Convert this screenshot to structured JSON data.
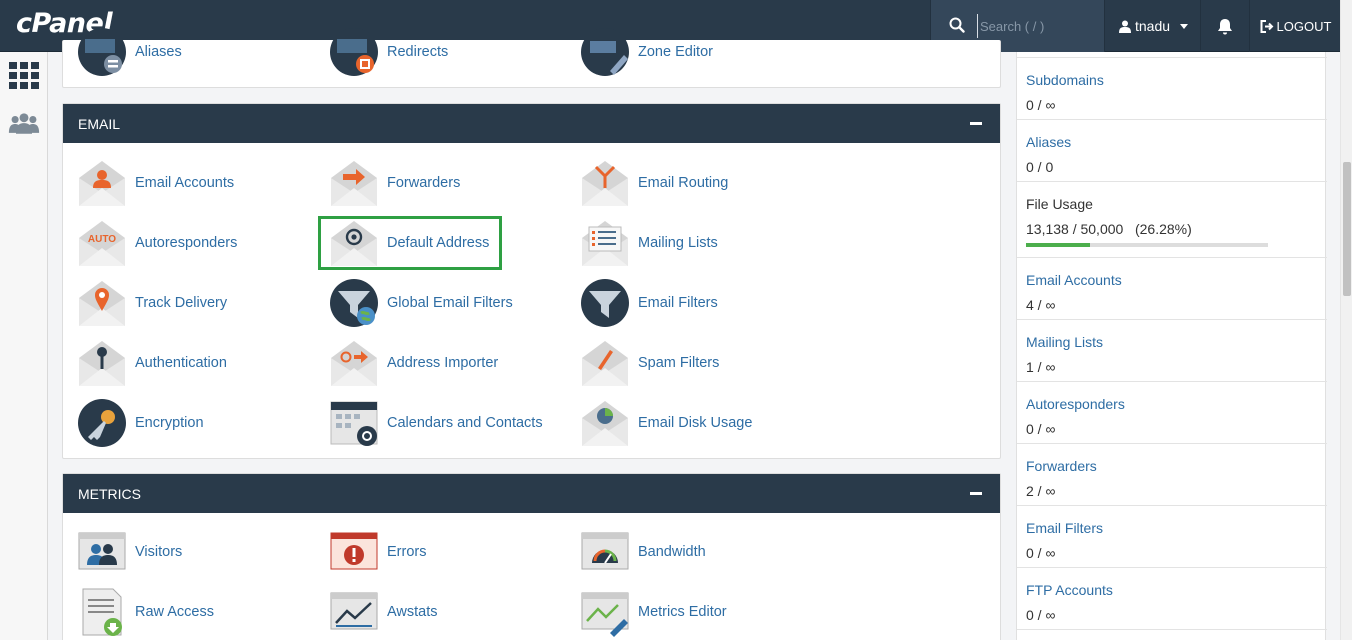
{
  "header": {
    "logo": "cPanel",
    "search_placeholder": "Search ( / )",
    "username": "tnadu",
    "logout_label": "LOGOUT"
  },
  "domains_partial": {
    "items": [
      {
        "label": "Aliases",
        "icon": "aliases-icon"
      },
      {
        "label": "Redirects",
        "icon": "redirects-icon"
      },
      {
        "label": "Zone Editor",
        "icon": "zone-editor-icon"
      }
    ]
  },
  "email": {
    "title": "EMAIL",
    "items": [
      {
        "label": "Email Accounts",
        "icon": "email-accounts-icon"
      },
      {
        "label": "Forwarders",
        "icon": "forwarders-icon"
      },
      {
        "label": "Email Routing",
        "icon": "email-routing-icon"
      },
      {
        "label": "Autoresponders",
        "icon": "autoresponders-icon"
      },
      {
        "label": "Default Address",
        "icon": "default-address-icon"
      },
      {
        "label": "Mailing Lists",
        "icon": "mailing-lists-icon"
      },
      {
        "label": "Track Delivery",
        "icon": "track-delivery-icon"
      },
      {
        "label": "Global Email Filters",
        "icon": "global-email-filters-icon"
      },
      {
        "label": "Email Filters",
        "icon": "email-filters-icon"
      },
      {
        "label": "Authentication",
        "icon": "authentication-icon"
      },
      {
        "label": "Address Importer",
        "icon": "address-importer-icon"
      },
      {
        "label": "Spam Filters",
        "icon": "spam-filters-icon"
      },
      {
        "label": "Encryption",
        "icon": "encryption-icon"
      },
      {
        "label": "Calendars and Contacts",
        "icon": "calendars-contacts-icon"
      },
      {
        "label": "Email Disk Usage",
        "icon": "email-disk-usage-icon"
      }
    ],
    "auto_text": "AUTO"
  },
  "metrics": {
    "title": "METRICS",
    "items": [
      {
        "label": "Visitors",
        "icon": "visitors-icon"
      },
      {
        "label": "Errors",
        "icon": "errors-icon"
      },
      {
        "label": "Bandwidth",
        "icon": "bandwidth-icon"
      },
      {
        "label": "Raw Access",
        "icon": "raw-access-icon"
      },
      {
        "label": "Awstats",
        "icon": "awstats-icon"
      },
      {
        "label": "Metrics Editor",
        "icon": "metrics-editor-icon"
      }
    ]
  },
  "stats": {
    "items": [
      {
        "name": "Subdomains",
        "value": "0 / ∞"
      },
      {
        "name": "Aliases",
        "value": "0 / 0"
      },
      {
        "name": "File Usage",
        "value": "13,138 / 50,000   (26.28%)",
        "usage_percent": 26.28
      },
      {
        "name": "Email Accounts",
        "value": "4 / ∞"
      },
      {
        "name": "Mailing Lists",
        "value": "1 / ∞"
      },
      {
        "name": "Autoresponders",
        "value": "0 / ∞"
      },
      {
        "name": "Forwarders",
        "value": "2 / ∞"
      },
      {
        "name": "Email Filters",
        "value": "0 / ∞"
      },
      {
        "name": "FTP Accounts",
        "value": "0 / ∞"
      }
    ]
  },
  "colors": {
    "header_bg": "#293a4a",
    "link": "#2e6da4",
    "highlight": "#2ea043",
    "accent_orange": "#e8642c",
    "usage_bar": "#4cae4c"
  }
}
